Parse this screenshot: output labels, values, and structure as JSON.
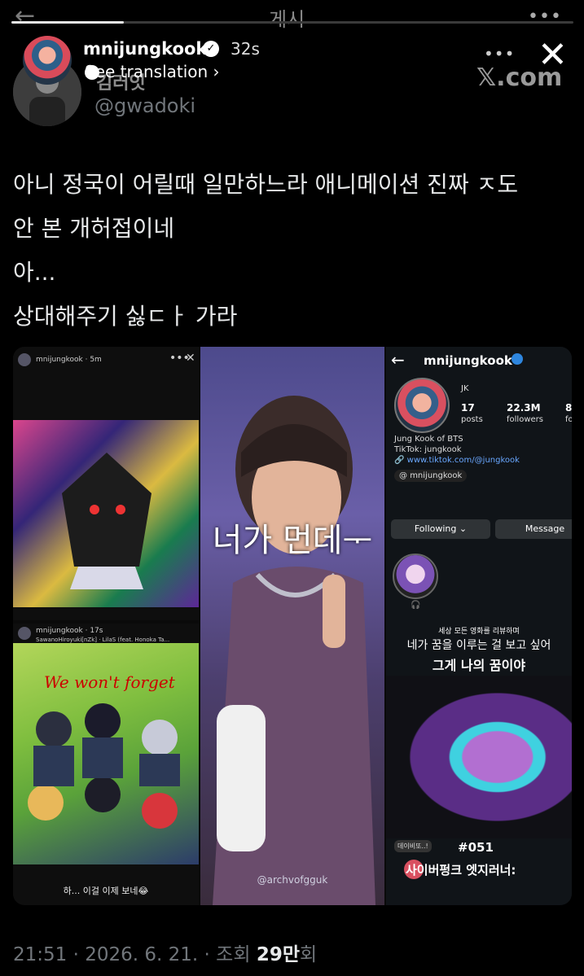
{
  "top": {
    "title": "게시",
    "progress": 0.2
  },
  "story": {
    "username": "mnijungkook",
    "time": "32s",
    "see_translation": "See translation",
    "brand": "𝕏.com"
  },
  "author": {
    "name": "김러잇",
    "handle": "@gwadoki"
  },
  "tweet": {
    "text": "아니 정국이 어릴때 일만하느라 애니메이션 진짜 ㅈ도\n안 본 개허접이네\n아...\n상대해주기 싫ㄷㅏ 가라"
  },
  "media": {
    "panel1": {
      "username": "mnijungkook",
      "time": "5m"
    },
    "panel2": {
      "username": "mnijungkook",
      "time": "17s",
      "music": "SawanoHiroyuki[nZk] · LilaS (feat. Honoka Ta...",
      "art_text": "We won't forget",
      "caption": "하... 이걸 이제 보네😂"
    },
    "panel3": {
      "overlay": "너가 먼데ᅮ",
      "watermark": "@archvofgguk"
    },
    "panel4": {
      "username": "mnijungkook",
      "name": "JK",
      "posts_count": "17",
      "posts_label": "posts",
      "followers_count": "22.3M",
      "followers_label": "followers",
      "following_count": "8",
      "following_label": "fo",
      "bio1": "Jung Kook of BTS",
      "bio2": "TikTok: jungkook",
      "link": "www.tiktok.com/@jungkook",
      "threads": "mnijungkook",
      "following_btn": "Following",
      "message_btn": "Message",
      "kr_line1": "세상 모든 영화를 리뷰하며",
      "kr_line2": "네가 꿈을 이루는 걸 보고 싶어",
      "kr_line3": "그게 나의 꿈이야",
      "reply_tag": "데이비또..!",
      "number": "#051",
      "bottom_title": "사이버펑크 엣지러너:"
    }
  },
  "footer": {
    "time": "21:51",
    "date": "2026. 6. 21.",
    "views_label": "조회",
    "views_count": "29만",
    "views_suffix": "회"
  }
}
